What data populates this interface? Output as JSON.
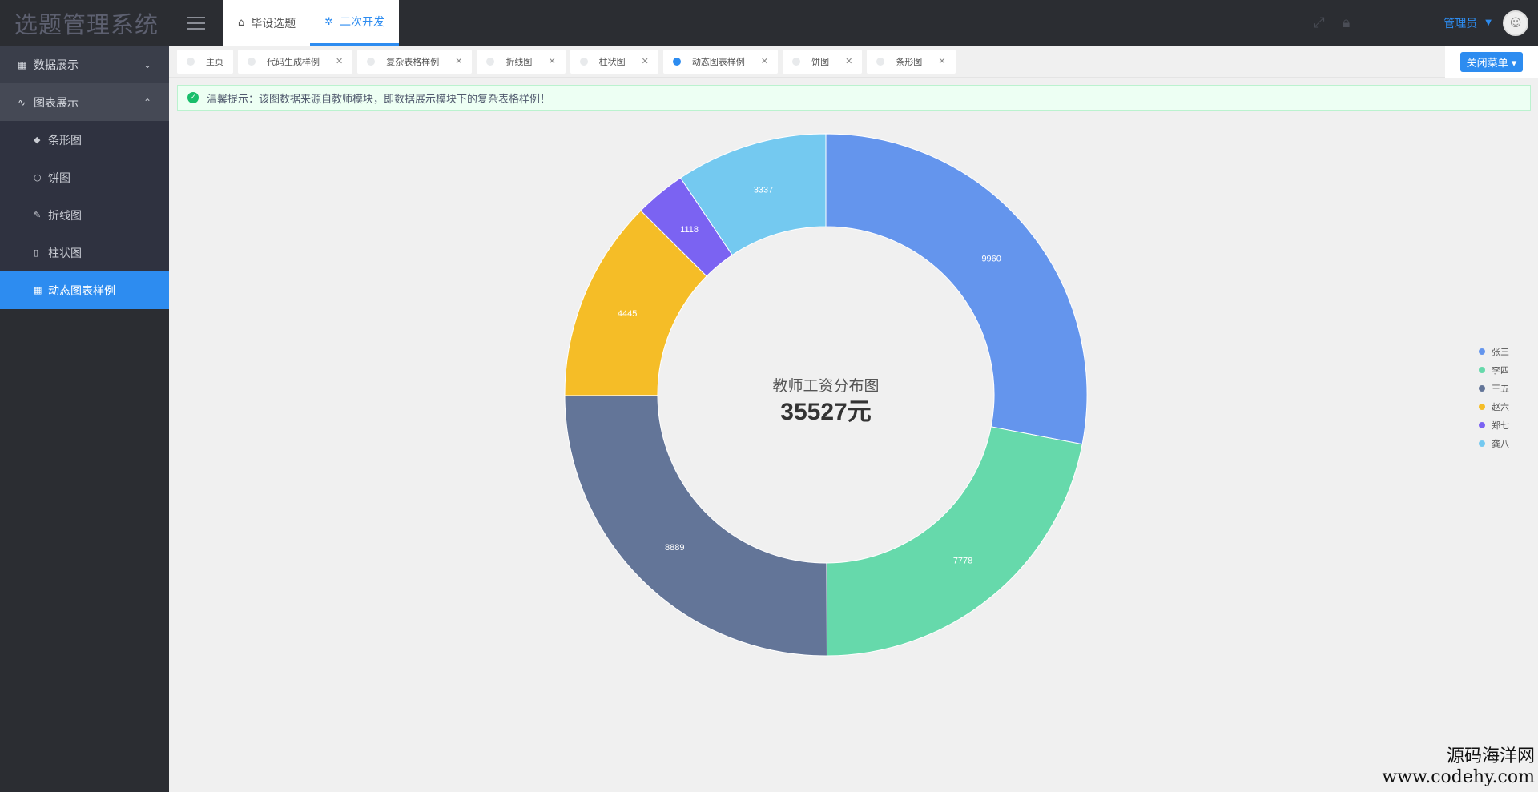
{
  "app": {
    "title": "选题管理系统"
  },
  "sidebar": {
    "groups": [
      {
        "label": "数据展示",
        "icon": "grid-icon",
        "expanded": false
      },
      {
        "label": "图表展示",
        "icon": "pulse-icon",
        "expanded": true,
        "items": [
          {
            "label": "条形图",
            "icon": "tag-icon"
          },
          {
            "label": "饼图",
            "icon": "circle-icon"
          },
          {
            "label": "折线图",
            "icon": "pen-icon"
          },
          {
            "label": "柱状图",
            "icon": "bar-icon"
          },
          {
            "label": "动态图表样例",
            "icon": "grid-icon",
            "active": true
          }
        ]
      }
    ]
  },
  "header": {
    "tabs": [
      {
        "label": "毕设选题",
        "icon": "home-icon"
      },
      {
        "label": "二次开发",
        "icon": "bug-icon",
        "active": true
      }
    ],
    "user": "管理员"
  },
  "tabs": [
    {
      "label": "主页",
      "closable": false
    },
    {
      "label": "代码生成样例",
      "closable": true
    },
    {
      "label": "复杂表格样例",
      "closable": true
    },
    {
      "label": "折线图",
      "closable": true
    },
    {
      "label": "柱状图",
      "closable": true
    },
    {
      "label": "动态图表样例",
      "closable": true,
      "active": true
    },
    {
      "label": "饼图",
      "closable": true
    },
    {
      "label": "条形图",
      "closable": true
    }
  ],
  "close_menu_label": "关闭菜单",
  "notice": "温馨提示：该图数据来源自教师模块，即数据展示模块下的复杂表格样例！",
  "chart_data": {
    "type": "pie",
    "donut": true,
    "title": "教师工资分布图",
    "subtitle": "35527元",
    "categories": [
      "张三",
      "李四",
      "王五",
      "赵六",
      "郑七",
      "龚八"
    ],
    "values": [
      9960,
      7778,
      8889,
      4445,
      1118,
      3337
    ],
    "colors": [
      "#6495ed",
      "#66d9ab",
      "#637598",
      "#f5bd27",
      "#7b63f2",
      "#74c9f0"
    ],
    "legend": "right"
  },
  "watermark": {
    "line1": "源码海洋网",
    "line2": "www.codehy.com"
  }
}
